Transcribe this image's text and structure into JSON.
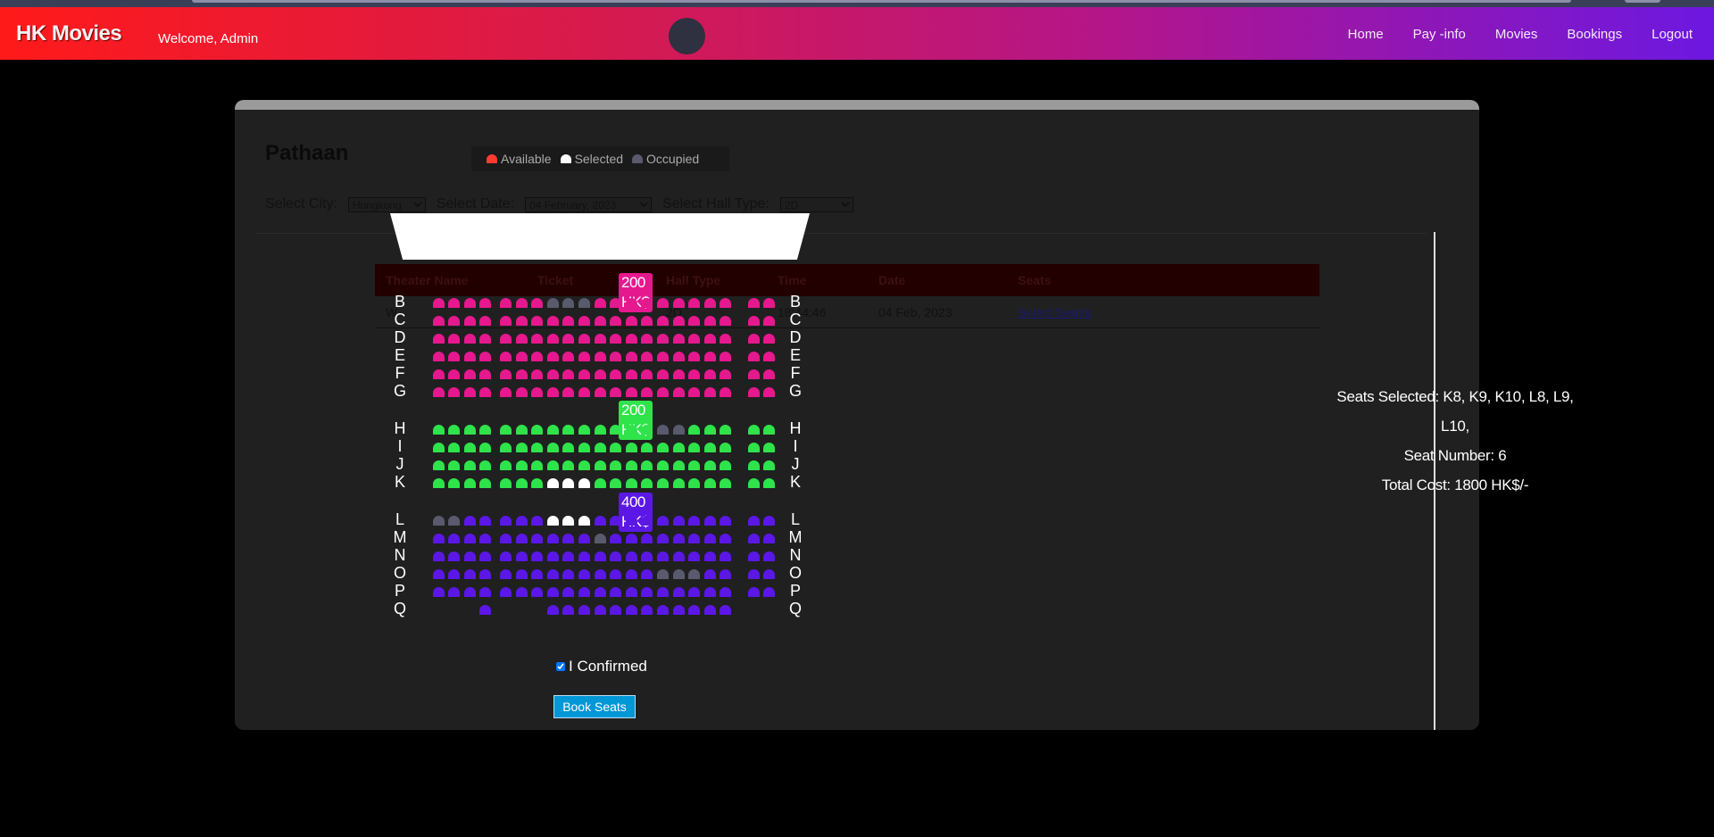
{
  "nav": {
    "brand": "HK Movies",
    "welcome": "Welcome, Admin",
    "links": [
      "Home",
      "Pay -info",
      "Movies",
      "Bookings",
      "Logout"
    ]
  },
  "movie": {
    "title": "Pathaan",
    "legend": [
      {
        "label": "Available",
        "color": "#ff3b30"
      },
      {
        "label": "Selected",
        "color": "#ffffff"
      },
      {
        "label": "Occupied",
        "color": "#5a5a6e"
      }
    ]
  },
  "filters": {
    "city_label": "Select City:",
    "city_value": "Hongkong",
    "date_label": "Select Date:",
    "date_value": "04 February, 2023",
    "hall_label": "Select Hall Type:",
    "hall_value": "2D"
  },
  "table": {
    "headers": [
      "Theater Name",
      "Ticket",
      "Hall Type",
      "Time",
      "Date",
      "Seats"
    ],
    "row": {
      "theater": "W...",
      "ticket": "",
      "hall": "2D",
      "time": "18:44:46",
      "date": "04 Feb, 2023",
      "action": "Select Seat/s"
    }
  },
  "colors": {
    "pink": "#e6188e",
    "green": "#2fe34b",
    "purple": "#5b17e6",
    "occupied": "#5a5a6e",
    "selected": "#ffffff"
  },
  "sections": [
    {
      "price": "200 HK$",
      "color": "#e6188e",
      "rows": [
        "B",
        "C",
        "D",
        "E",
        "F",
        "G"
      ]
    },
    {
      "price": "200 HK$",
      "color": "#2fe34b",
      "rows": [
        "H",
        "I",
        "J",
        "K"
      ]
    },
    {
      "price": "400 HK$",
      "color": "#5b17e6",
      "rows": [
        "L",
        "M",
        "N",
        "O",
        "P",
        "Q"
      ]
    }
  ],
  "seat_states": {
    "B": {
      "occupied": [
        8,
        9,
        10
      ],
      "selected": []
    },
    "C": {
      "occupied": [],
      "selected": []
    },
    "D": {
      "occupied": [],
      "selected": []
    },
    "E": {
      "occupied": [],
      "selected": []
    },
    "F": {
      "occupied": [],
      "selected": []
    },
    "G": {
      "occupied": [],
      "selected": []
    },
    "H": {
      "occupied": [
        15,
        16
      ],
      "selected": []
    },
    "I": {
      "occupied": [],
      "selected": []
    },
    "J": {
      "occupied": [],
      "selected": []
    },
    "K": {
      "occupied": [],
      "selected": [
        8,
        9,
        10
      ]
    },
    "L": {
      "occupied": [
        1,
        2
      ],
      "selected": [
        8,
        9,
        10
      ]
    },
    "M": {
      "occupied": [
        11
      ],
      "selected": []
    },
    "N": {
      "occupied": [],
      "selected": []
    },
    "O": {
      "occupied": [
        15,
        16,
        17
      ],
      "selected": []
    },
    "P": {
      "occupied": [],
      "selected": []
    },
    "Q": {
      "occupied": [],
      "selected": []
    }
  },
  "summary": {
    "seats_selected": "Seats Selected: K8, K9, K10, L8, L9, L10,",
    "seat_number": "Seat Number: 6",
    "total_cost": "Total Cost: 1800 HK$/-"
  },
  "confirm_label": "I Confirmed",
  "book_label": "Book Seats"
}
